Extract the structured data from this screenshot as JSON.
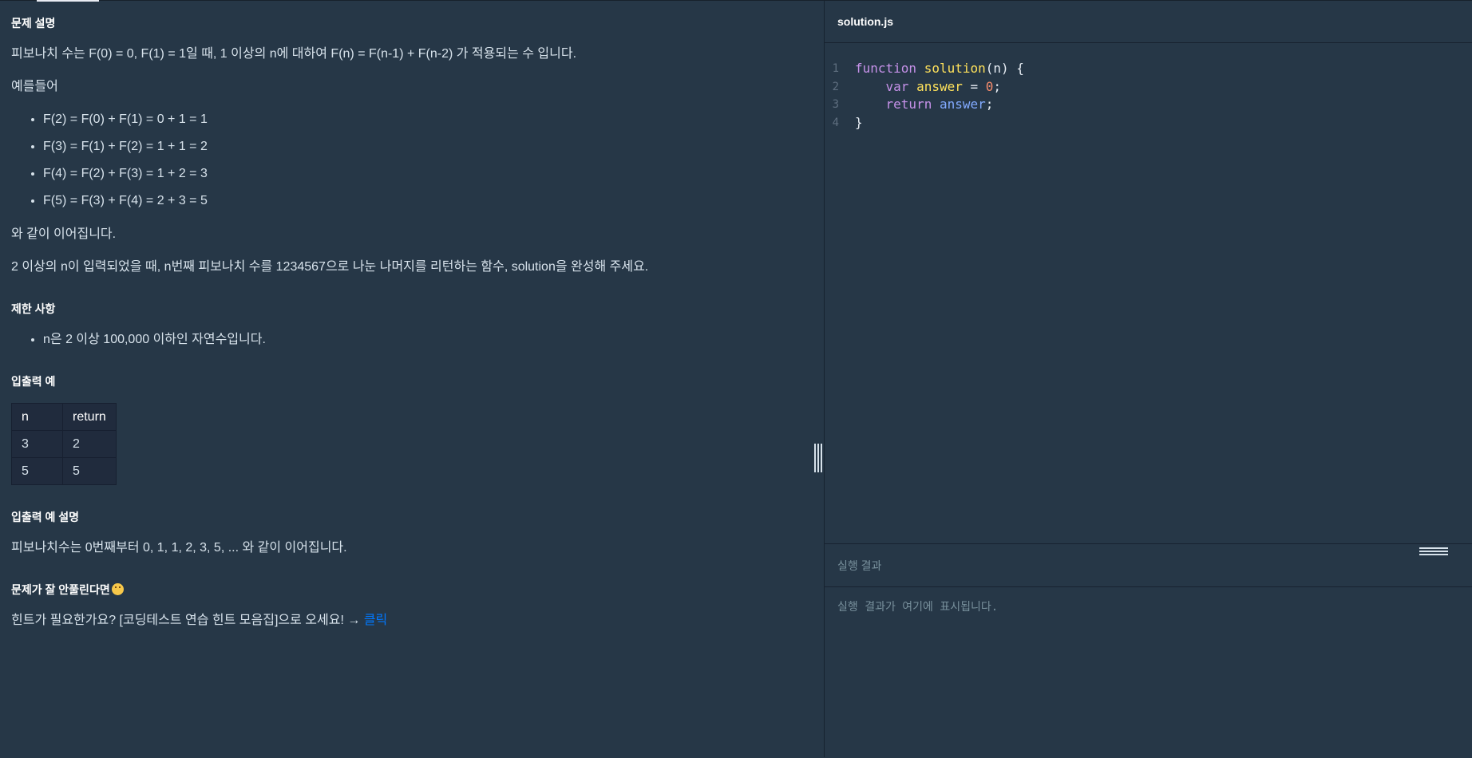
{
  "problem": {
    "description_title": "문제 설명",
    "intro": "피보나치 수는 F(0) = 0, F(1) = 1일 때, 1 이상의 n에 대하여 F(n) = F(n-1) + F(n-2) 가 적용되는 수 입니다.",
    "example_lead": "예를들어",
    "examples": [
      "F(2) = F(0) + F(1) = 0 + 1 = 1",
      "F(3) = F(1) + F(2) = 1 + 1 = 2",
      "F(4) = F(2) + F(3) = 1 + 2 = 3",
      "F(5) = F(3) + F(4) = 2 + 3 = 5"
    ],
    "continues": "와 같이 이어집니다.",
    "task": "2 이상의 n이 입력되었을 때, n번째 피보나치 수를 1234567으로 나눈 나머지를 리턴하는 함수, solution을 완성해 주세요.",
    "constraints_title": "제한 사항",
    "constraints": [
      "n은 2 이상 100,000 이하인 자연수입니다."
    ],
    "io_title": "입출력 예",
    "io_table": {
      "headers": [
        "n",
        "return"
      ],
      "rows": [
        [
          "3",
          "2"
        ],
        [
          "5",
          "5"
        ]
      ]
    },
    "io_explain_title": "입출력 예 설명",
    "io_explain": "피보나치수는 0번째부터 0, 1, 1, 2, 3, 5, ... 와 같이 이어집니다.",
    "hint_title": "문제가 잘 안풀린다면",
    "hint_text": "힌트가 필요한가요? [코딩테스트 연습 힌트 모음집]으로 오세요! → ",
    "hint_link": "클릭"
  },
  "editor": {
    "filename": "solution.js",
    "line_numbers": [
      "1",
      "2",
      "3",
      "4"
    ],
    "tokens": {
      "function_kw": "function",
      "fn_name": "solution",
      "params": "(n) {",
      "var_kw": "var",
      "var_name": "answer",
      "assign": " = ",
      "zero": "0",
      "semi": ";",
      "return_kw": "return",
      "return_val": "answer",
      "close": "}"
    }
  },
  "result": {
    "title": "실행 결과",
    "placeholder": "실행 결과가 여기에 표시됩니다."
  },
  "colors": {
    "background": "#263747",
    "link": "#0078ff",
    "keyword": "#c792ea",
    "function_name": "#ffe25b"
  }
}
